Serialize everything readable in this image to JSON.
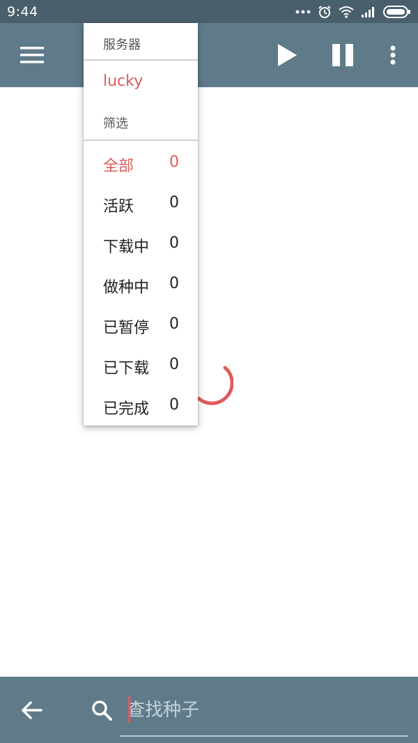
{
  "status_bar": {
    "time": "9:44",
    "icons": [
      "more-dots-icon",
      "alarm-icon",
      "wifi-icon",
      "signal-icon",
      "battery-icon"
    ]
  },
  "app_bar": {
    "icons": [
      "menu-icon",
      "play-icon",
      "pause-icon",
      "more-vert-icon"
    ]
  },
  "dropdown": {
    "server_header": "服务器",
    "server_item": "lucky",
    "filter_header": "筛选",
    "filters": [
      {
        "label": "全部",
        "count": "0",
        "active": true
      },
      {
        "label": "活跃",
        "count": "0",
        "active": false
      },
      {
        "label": "下载中",
        "count": "0",
        "active": false
      },
      {
        "label": "做种中",
        "count": "0",
        "active": false
      },
      {
        "label": "已暂停",
        "count": "0",
        "active": false
      },
      {
        "label": "已下载",
        "count": "0",
        "active": false
      },
      {
        "label": "已完成",
        "count": "0",
        "active": false
      }
    ]
  },
  "content": {
    "loading_indicator": "spinner-icon"
  },
  "bottom_bar": {
    "icons": [
      "back-arrow-icon",
      "search-icon"
    ],
    "search_placeholder": "查找种子",
    "search_value": ""
  },
  "colors": {
    "status_bar": "#4a5f6c",
    "app_bar": "#5f7b8a",
    "accent": "#e05a5a",
    "text_primary": "#222222",
    "text_secondary": "#555555"
  }
}
